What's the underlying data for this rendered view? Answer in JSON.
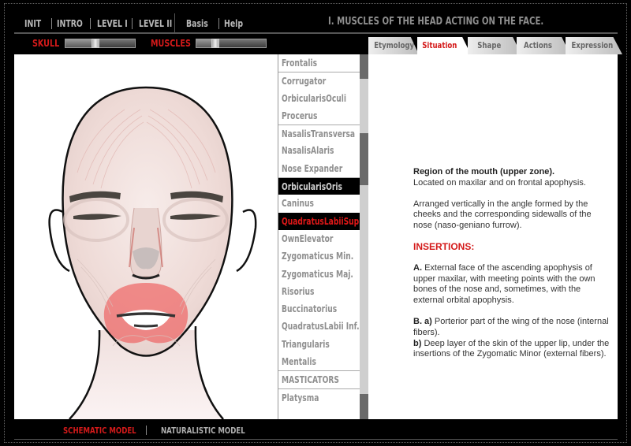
{
  "topnav": {
    "items": [
      "INIT",
      "INTRO",
      "LEVEL I",
      "LEVEL II"
    ],
    "extra": [
      "Basis",
      "Help"
    ]
  },
  "main_title": "I. MUSCLES OF THE HEAD ACTING ON THE FACE.",
  "sliders": {
    "skull": {
      "label": "SKULL",
      "value": 0.38
    },
    "muscles": {
      "label": "MUSCLES",
      "value": 0.22
    }
  },
  "tabs": [
    {
      "label": "Etymology",
      "active": false
    },
    {
      "label": "Situation",
      "active": true
    },
    {
      "label": "Shape",
      "active": false
    },
    {
      "label": "Actions",
      "active": false
    },
    {
      "label": "Expression",
      "active": false
    }
  ],
  "muscle_list": [
    {
      "label": "Frontalis",
      "group_start": true
    },
    {
      "label": "Corrugator",
      "group_start": true
    },
    {
      "label": "OrbicularisOculi"
    },
    {
      "label": "Procerus"
    },
    {
      "label": "NasalisTransversa",
      "group_start": true
    },
    {
      "label": "NasalisAlaris"
    },
    {
      "label": "Nose Expander"
    },
    {
      "label": "OrbicularisOris",
      "state": "selected",
      "group_start": true
    },
    {
      "label": "Caninus"
    },
    {
      "label": "QuadratusLabiiSup.",
      "state": "highlight"
    },
    {
      "label": "OwnElevator"
    },
    {
      "label": "Zygomaticus Min."
    },
    {
      "label": "Zygomaticus Maj."
    },
    {
      "label": "Risorius"
    },
    {
      "label": "Buccinatorius"
    },
    {
      "label": "QuadratusLabii Inf."
    },
    {
      "label": "Triangularis"
    },
    {
      "label": "Mentalis"
    },
    {
      "label": "MASTICATORS",
      "group_start": true
    },
    {
      "label": "Platysma",
      "group_start": true
    }
  ],
  "content": {
    "region_title": "Region of the mouth (upper zone).",
    "region_text": "Located on maxilar and on frontal apophysis.",
    "arranged": "Arranged vertically in the angle formed by the cheeks and the corresponding sidewalls of the nose (naso-geniano furrow).",
    "insertions_heading": "INSERTIONS:",
    "a_label": "A.",
    "a_text": "External face of the ascending apophysis of upper maxilar, with meeting points with the own bones of the nose and, sometimes, with the external orbital apophysis.",
    "ba_label": "B. a)",
    "ba_text": "Porterior part of the wing of the nose (internal fibers).",
    "bb_label": "b)",
    "bb_text": "Deep layer of the skin of the upper lip, under the insertions of the Zygomatic Minor (external fibers)."
  },
  "bottomnav": {
    "schematic": "SCHEMATIC MODEL",
    "naturalistic": "NATURALISTIC MODEL",
    "active": "schematic"
  },
  "colors": {
    "accent_red": "#d41a1a",
    "background": "#000000",
    "muscle_highlight": "#ee5a5a"
  }
}
